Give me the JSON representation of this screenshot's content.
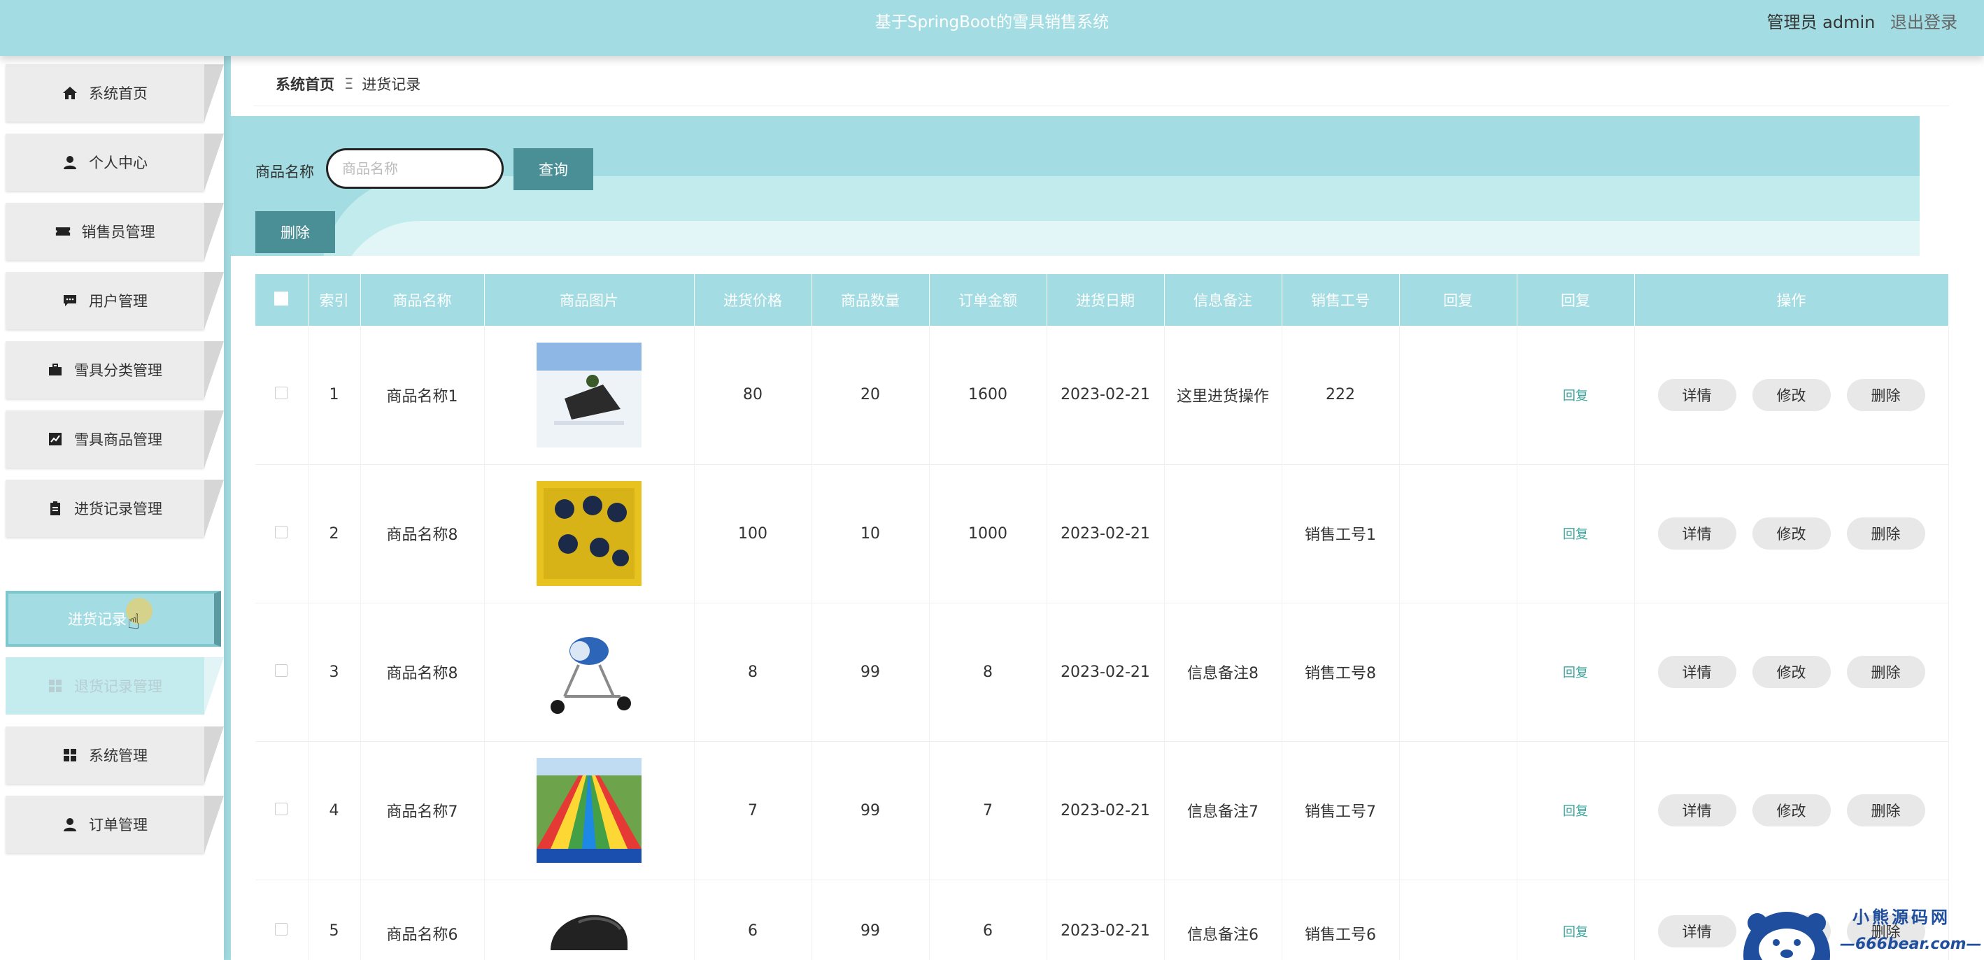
{
  "header": {
    "title": "基于SpringBoot的雪具销售系统",
    "user_label": "管理员 admin",
    "logout": "退出登录",
    "color": "#a3dde3"
  },
  "sidebar": {
    "items": [
      {
        "label": "系统首页",
        "icon": "home-icon"
      },
      {
        "label": "个人中心",
        "icon": "user-icon"
      },
      {
        "label": "销售员管理",
        "icon": "ticket-icon"
      },
      {
        "label": "用户管理",
        "icon": "chat-icon"
      },
      {
        "label": "雪具分类管理",
        "icon": "briefcase-icon"
      },
      {
        "label": "雪具商品管理",
        "icon": "chart-icon"
      },
      {
        "label": "进货记录管理",
        "icon": "clipboard-icon"
      },
      {
        "label": "退货记录管理",
        "icon": "grid-icon"
      },
      {
        "label": "系统管理",
        "icon": "grid-icon"
      },
      {
        "label": "订单管理",
        "icon": "user-icon"
      }
    ],
    "active_sub": "进货记录"
  },
  "breadcrumb": {
    "home": "系统首页",
    "sep": "Ξ",
    "current": "进货记录"
  },
  "search": {
    "label": "商品名称",
    "placeholder": "商品名称",
    "query_button": "查询",
    "delete_button": "删除"
  },
  "table": {
    "headers": [
      "索引",
      "商品名称",
      "商品图片",
      "进货价格",
      "商品数量",
      "订单金额",
      "进货日期",
      "信息备注",
      "销售工号",
      "回复",
      "回复",
      "操作"
    ],
    "rows": [
      {
        "index": "1",
        "name": "商品名称1",
        "image": "snowmobile-photo",
        "price": "80",
        "qty": "20",
        "amount": "1600",
        "date": "2023-02-21",
        "note": "这里进货操作",
        "staff": "222",
        "reply": "",
        "reply_link": "回复"
      },
      {
        "index": "2",
        "name": "商品名称8",
        "image": "ski-boots-rack-photo",
        "price": "100",
        "qty": "10",
        "amount": "1000",
        "date": "2023-02-21",
        "note": "",
        "staff": "销售工号1",
        "reply": "",
        "reply_link": "回复"
      },
      {
        "index": "3",
        "name": "商品名称8",
        "image": "snow-cannon-photo",
        "price": "8",
        "qty": "99",
        "amount": "8",
        "date": "2023-02-21",
        "note": "信息备注8",
        "staff": "销售工号8",
        "reply": "",
        "reply_link": "回复"
      },
      {
        "index": "4",
        "name": "商品名称7",
        "image": "rainbow-slide-photo",
        "price": "7",
        "qty": "99",
        "amount": "7",
        "date": "2023-02-21",
        "note": "信息备注7",
        "staff": "销售工号7",
        "reply": "",
        "reply_link": "回复"
      },
      {
        "index": "5",
        "name": "商品名称6",
        "image": "helmet-photo",
        "price": "6",
        "qty": "99",
        "amount": "6",
        "date": "2023-02-21",
        "note": "信息备注6",
        "staff": "销售工号6",
        "reply": "",
        "reply_link": "回复"
      }
    ],
    "actions": {
      "detail": "详情",
      "edit": "修改",
      "delete": "删除"
    }
  },
  "watermark": {
    "line1": "小熊源码网",
    "line2": "—666bear.com—"
  }
}
